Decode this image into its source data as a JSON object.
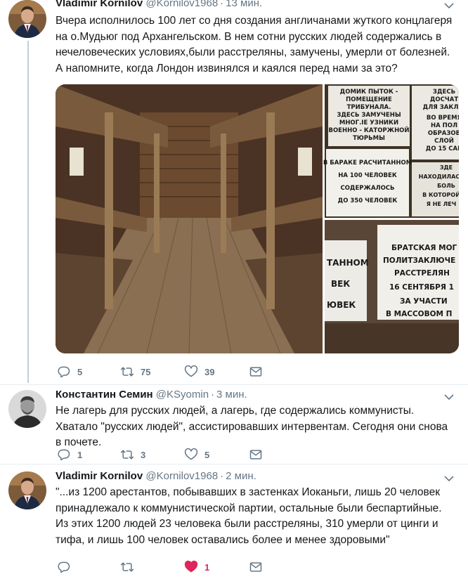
{
  "tweets": [
    {
      "name": "Vladimir Kornilov",
      "handle": "@Kornilov1968",
      "separator": "·",
      "time": "13 мин.",
      "text": "Вчера исполнилось 100 лет со дня создания англичанами жуткого концлагеря на о.Мудьюг под Архангельском. В нем сотни русских людей содержались в нечеловеческих условиях,были расстреляны, замучены, умерли от болезней. А напомните, когда Лондон извинялся и каялся перед нами за это?",
      "avatar_icon": "avatar-suit-man",
      "media": {
        "photo1_sign": [
          "ДОМИК ПЫТОК -",
          "ПОМЕЩЕНИЕ",
          "ТРИБУНАЛА.",
          "ЗДЕСЬ ЗАМУЧЕНЫ",
          "МНОГ.IE УЗНИКИ",
          "ВОЕННО - КАТОРЖНОЙ",
          "ТЮРЬМЫ"
        ],
        "photo2_sign": [
          "ЗДЕСЬ",
          "ДОСЧАТ",
          "ДЛЯ ЗАКЛЮ",
          "ВО ВРЕМЯ",
          "НА ПОЛ",
          "ОБРАЗОВ",
          "СЛОЙ",
          "ДО 15 САН"
        ],
        "photo3_sign": [
          "В БАРАКЕ РАСЧИТАННОМ",
          "НА 100 ЧЕЛОВЕК",
          "СОДЕРЖАЛОСЬ",
          "ДО 350 ЧЕЛОВЕК"
        ],
        "photo4_sign": [
          "ЗДЕ",
          "НАХОДИЛАСЬ",
          "БОЛЬ",
          "В КОТОРОЙ",
          "Я НЕ ЛЕЧ"
        ],
        "photo5_sign": [
          "ТАННОМ",
          "ВЕК",
          "ЮВЕК"
        ],
        "photo6_sign": [
          "БРАТСКАЯ МОГ",
          "ПОЛИТЗАКЛЮЧЕ",
          "РАССТРЕЛЯН",
          "16 СЕНТЯБРЯ 1",
          "ЗА УЧАСТИ",
          "В МАССОВОМ П"
        ]
      },
      "actions": {
        "reply": "5",
        "retweet": "75",
        "like": "39"
      },
      "liked": false
    },
    {
      "name": "Константин Семин",
      "handle": "@KSyomin",
      "separator": "·",
      "time": "3 мин.",
      "text": "Не лагерь для русских людей, а лагерь, где содержались коммунисты. Хватало \"русских людей\", ассистировавших интервентам. Сегодня они снова в почете.",
      "avatar_icon": "avatar-bw-man",
      "actions": {
        "reply": "1",
        "retweet": "3",
        "like": "5"
      },
      "liked": false
    },
    {
      "name": "Vladimir Kornilov",
      "handle": "@Kornilov1968",
      "separator": "·",
      "time": "2 мин.",
      "text": "\"...из 1200 арестантов, побывавших в застенках Иоканьги, лишь 20 человек принадлежало к коммунистической партии, остальные были беспартийные. Из этих 1200 людей 23 человека были расстреляны, 310 умерли от цинги и тифа, и лишь 100 человек оставались более и менее здоровыми\"",
      "avatar_icon": "avatar-suit-man",
      "actions": {
        "reply": "",
        "retweet": "",
        "like": "1"
      },
      "liked": true
    }
  ],
  "colors": {
    "like_active": "#e0245e",
    "muted": "#657786",
    "thread_line": "#c4cfd6"
  },
  "icons": {
    "reply": "reply-icon",
    "retweet": "retweet-icon",
    "like": "heart-icon",
    "dm": "envelope-icon",
    "menu": "chevron-down-icon"
  }
}
